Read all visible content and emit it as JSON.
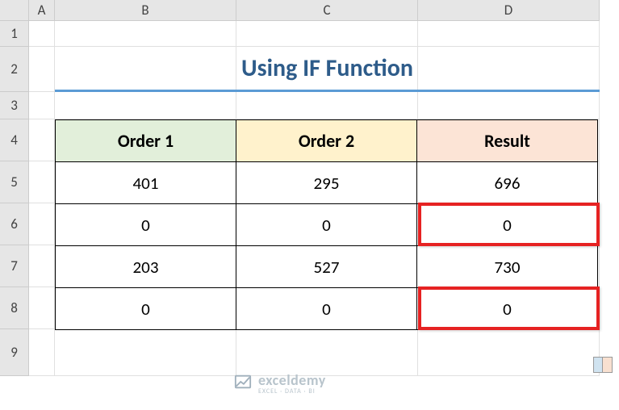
{
  "columns": {
    "A": "A",
    "B": "B",
    "C": "C",
    "D": "D"
  },
  "rows": {
    "1": "1",
    "2": "2",
    "3": "3",
    "4": "4",
    "5": "5",
    "6": "6",
    "7": "7",
    "8": "8",
    "9": "9"
  },
  "title": "Using IF Function",
  "headers": {
    "b": "Order 1",
    "c": "Order 2",
    "d": "Result"
  },
  "chart_data": {
    "type": "table",
    "title": "Using IF Function",
    "columns": [
      "Order 1",
      "Order 2",
      "Result"
    ],
    "rows": [
      {
        "order1": 401,
        "order2": 295,
        "result": 696
      },
      {
        "order1": 0,
        "order2": 0,
        "result": 0
      },
      {
        "order1": 203,
        "order2": 527,
        "result": 730
      },
      {
        "order1": 0,
        "order2": 0,
        "result": 0
      }
    ],
    "highlighted_result_rows": [
      1,
      3
    ]
  },
  "watermark": {
    "name": "exceldemy",
    "tag": "EXCEL · DATA · BI"
  }
}
